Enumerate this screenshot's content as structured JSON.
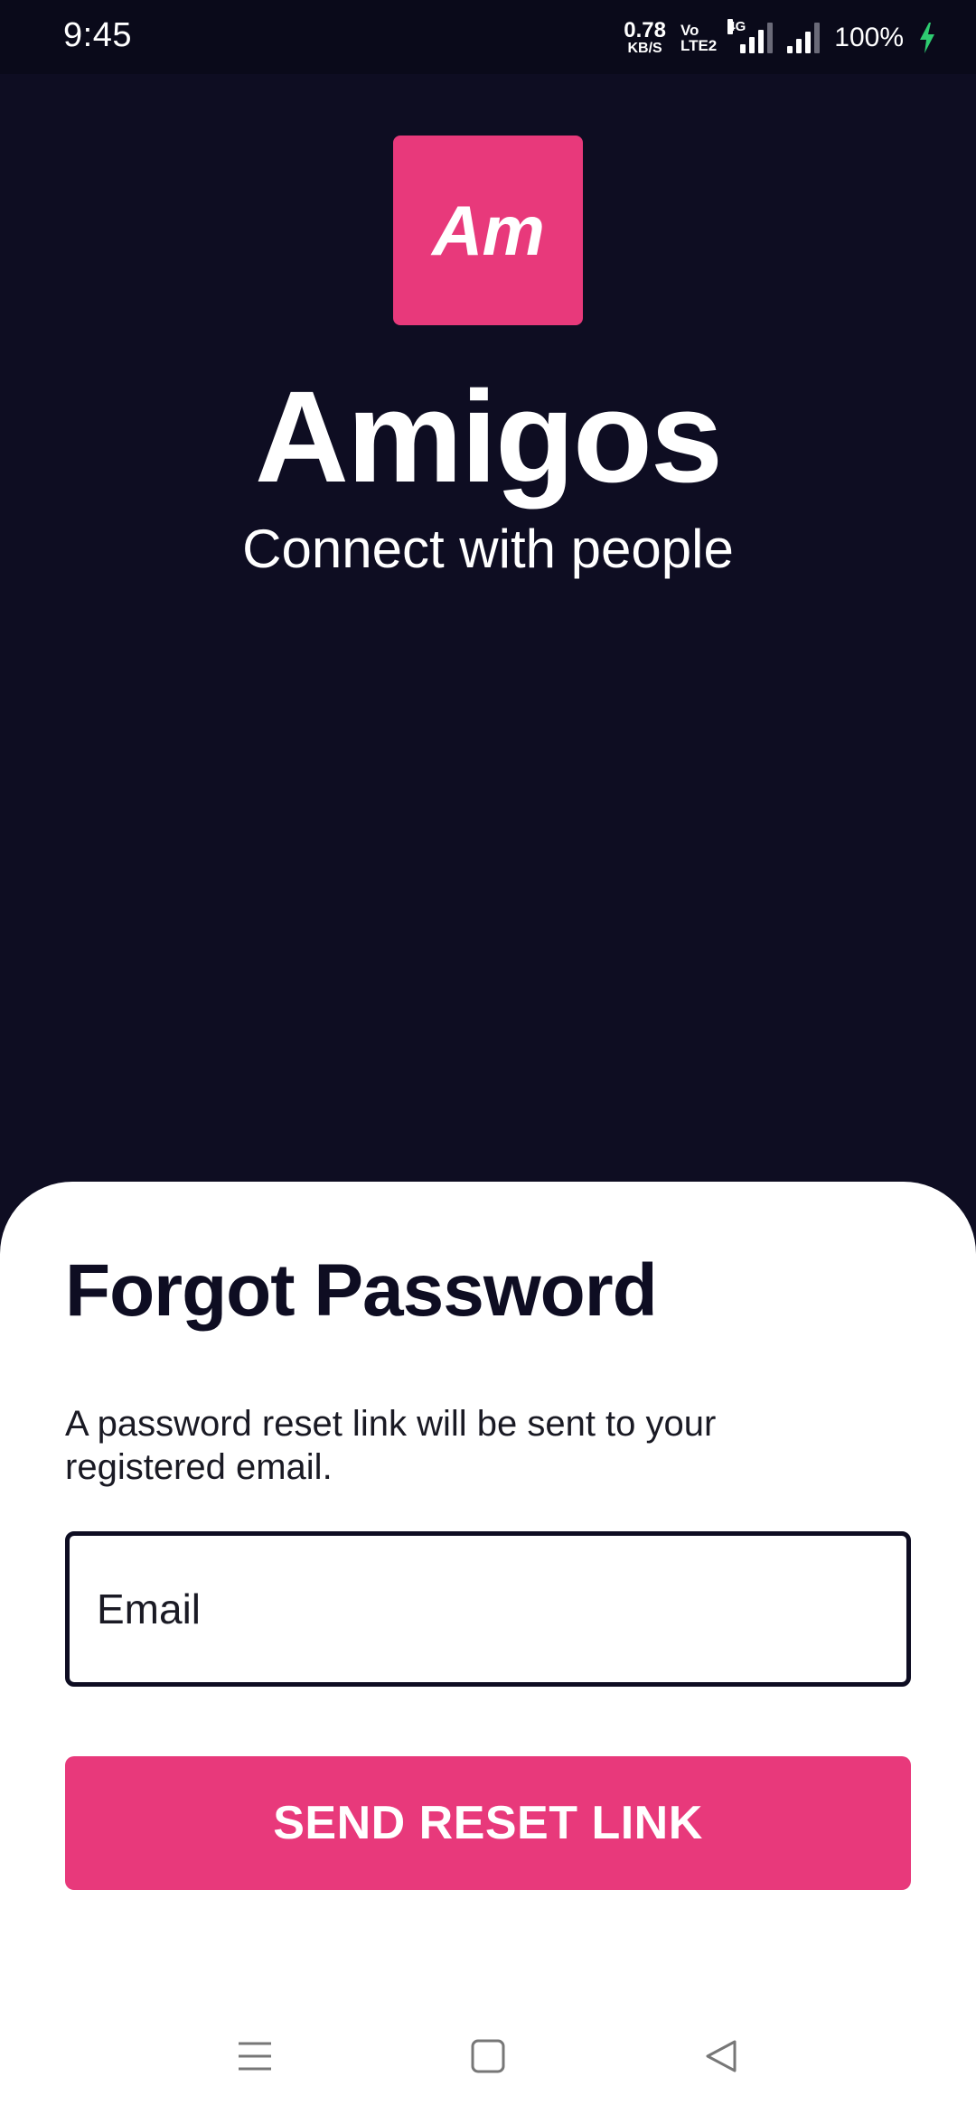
{
  "status_bar": {
    "time": "9:45",
    "net_speed_value": "0.78",
    "net_speed_unit": "KB/S",
    "volte_line1": "Vo",
    "volte_line2": "LTE2",
    "network_type": "4G",
    "battery": "100%",
    "charging_color": "#2ecc71"
  },
  "brand": {
    "logo_text": "Am",
    "app_name": "Amigos",
    "tagline": "Connect with people",
    "accent_color": "#e8397b",
    "background_color": "#0e0d22"
  },
  "forgot_password": {
    "title": "Forgot Password",
    "description": "A password reset link will be sent to your registered email.",
    "email_placeholder": "Email",
    "email_value": "",
    "submit_label": "SEND RESET LINK"
  },
  "nav_bar": {
    "icons": [
      "menu-icon",
      "home-square-icon",
      "back-triangle-icon"
    ]
  }
}
